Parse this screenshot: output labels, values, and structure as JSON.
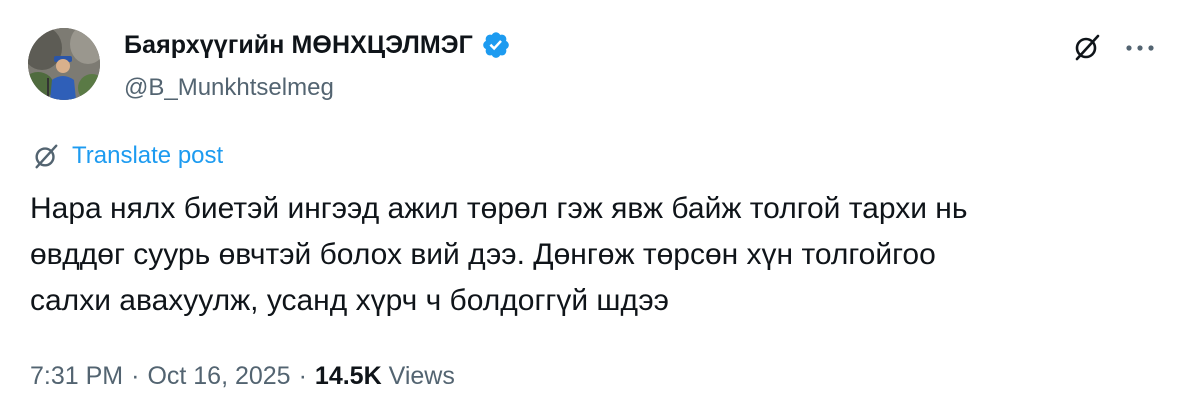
{
  "author": {
    "display_name": "Баярхүүгийн МӨНХЦЭЛМЭГ",
    "handle": "@B_Munkhtselmeg",
    "verified": true
  },
  "actions": {
    "grok_icon": "grok-icon",
    "more_icon": "more-icon"
  },
  "translate": {
    "label": "Translate post",
    "icon": "grok-icon"
  },
  "tweet": {
    "lines": [
      "Нара нялх биетэй ингээд ажил төрөл гэж явж байж толгой тархи нь",
      "өвддөг суурь өвчтэй болох вий дээ. Дөнгөж төрсөн хүн толгойгоо",
      "салхи авахуулж, усанд хүрч ч болдоггүй шдээ"
    ]
  },
  "meta": {
    "time": "7:31 PM",
    "date": "Oct 16, 2025",
    "separator": "·",
    "views_count": "14.5K",
    "views_label": "Views"
  },
  "colors": {
    "text": "#0f1419",
    "secondary": "#536471",
    "link": "#1d9bf0",
    "verified": "#1d9bf0"
  }
}
